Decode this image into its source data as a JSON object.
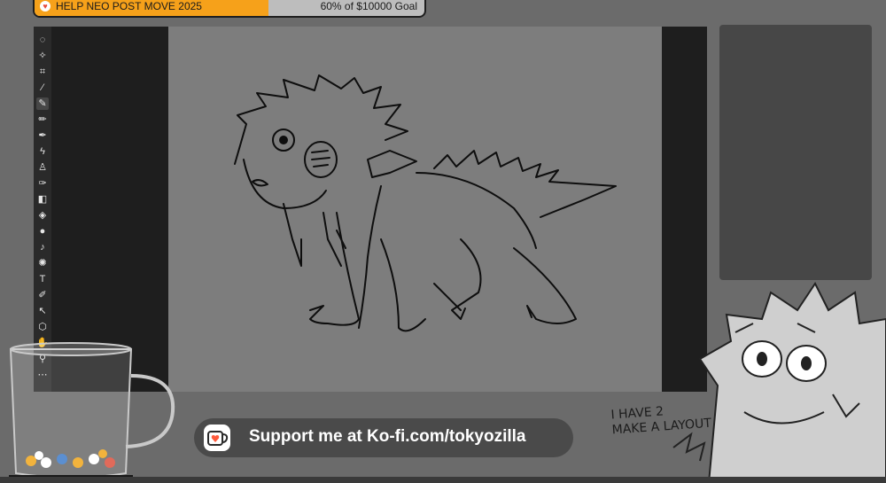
{
  "goal": {
    "title": "HELP NEO POST MOVE 2025",
    "progress_text": "60% of $10000 Goal",
    "progress_fraction": 0.6,
    "fill_color": "#f6a11a",
    "icon": "heart-icon"
  },
  "toolbar": {
    "tools": [
      {
        "name": "lasso-tool-icon",
        "glyph": "◌"
      },
      {
        "name": "magic-wand-icon",
        "glyph": "✧"
      },
      {
        "name": "crop-tool-icon",
        "glyph": "⌗"
      },
      {
        "name": "eyedropper-icon",
        "glyph": "⁄"
      },
      {
        "name": "brush-tool-icon",
        "glyph": "✎",
        "active": true
      },
      {
        "name": "pencil-tool-icon",
        "glyph": "✏"
      },
      {
        "name": "mixer-brush-icon",
        "glyph": "✒"
      },
      {
        "name": "history-brush-icon",
        "glyph": "ϟ"
      },
      {
        "name": "stamp-tool-icon",
        "glyph": "♙"
      },
      {
        "name": "art-brush-icon",
        "glyph": "✑"
      },
      {
        "name": "eraser-tool-icon",
        "glyph": "◧"
      },
      {
        "name": "paint-bucket-icon",
        "glyph": "◈"
      },
      {
        "name": "blur-tool-icon",
        "glyph": "●"
      },
      {
        "name": "dodge-tool-icon",
        "glyph": "♪"
      },
      {
        "name": "sponge-tool-icon",
        "glyph": "✺"
      },
      {
        "name": "type-tool-icon",
        "glyph": "T"
      },
      {
        "name": "pen-tool-icon",
        "glyph": "✐"
      },
      {
        "name": "path-select-icon",
        "glyph": "↖"
      },
      {
        "name": "shape-tool-icon",
        "glyph": "⬡"
      },
      {
        "name": "hand-tool-icon",
        "glyph": "✋"
      },
      {
        "name": "zoom-tool-icon",
        "glyph": "⚲"
      },
      {
        "name": "more-tools-icon",
        "glyph": "⋯"
      }
    ]
  },
  "kofi": {
    "text": "Support me at Ko-fi.com/tokyozilla",
    "icon": "kofi-cup-icon",
    "heart_color": "#ff5a3c"
  },
  "mascot": {
    "note": "I HAVE 2\nMAKE A LAYOUT"
  },
  "colors": {
    "background": "#6b6b6b",
    "canvas": "#7d7d7d",
    "workspace": "#1e1e1e",
    "panel": "#474747"
  }
}
